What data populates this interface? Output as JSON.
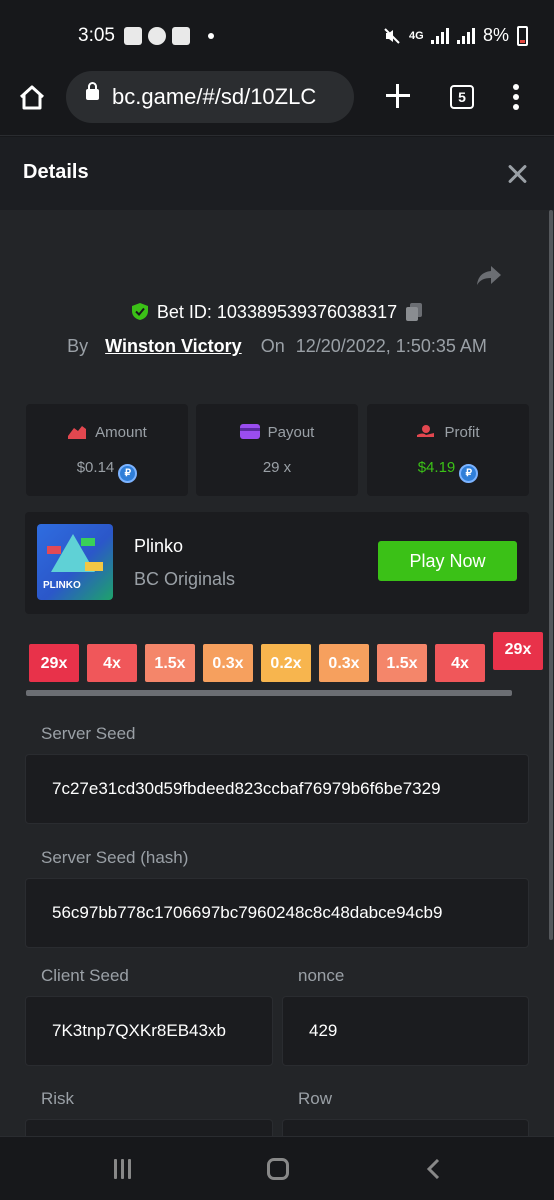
{
  "status_bar": {
    "time": "3:05",
    "network": "4G",
    "battery": "8%"
  },
  "browser": {
    "url": "bc.game/#/sd/10ZLC",
    "tab_count": "5"
  },
  "modal": {
    "title": "Details"
  },
  "bet": {
    "bet_id": "Bet ID: 103389539376038317",
    "by_label": "By",
    "user": "Winston Victory",
    "on_label": "On",
    "date": "12/20/2022, 1:50:35 AM"
  },
  "stats": [
    {
      "label": "Amount",
      "value": "$0.14",
      "color": "#9aa0a6"
    },
    {
      "label": "Payout",
      "value": "29 x",
      "color": "#9aa0a6"
    },
    {
      "label": "Profit",
      "value": "$4.19",
      "color": "#3bc117"
    }
  ],
  "game": {
    "name": "Plinko",
    "provider": "BC Originals",
    "thumb_text": "PLINKO",
    "play_label": "Play Now"
  },
  "multipliers": [
    {
      "label": "29x",
      "color": "#e8324a"
    },
    {
      "label": "4x",
      "color": "#f0575a"
    },
    {
      "label": "1.5x",
      "color": "#f4866a"
    },
    {
      "label": "0.3x",
      "color": "#f6a05e"
    },
    {
      "label": "0.2x",
      "color": "#f7b54e"
    },
    {
      "label": "0.3x",
      "color": "#f6a05e"
    },
    {
      "label": "1.5x",
      "color": "#f4866a"
    },
    {
      "label": "4x",
      "color": "#f0575a"
    },
    {
      "label": "29x",
      "color": "#e8324a",
      "hit": true
    }
  ],
  "seeds": {
    "server_seed_label": "Server Seed",
    "server_seed": "7c27e31cd30d59fbdeed823ccbaf76979b6f6be7329",
    "server_hash_label": "Server Seed (hash)",
    "server_hash": "56c97bb778c1706697bc7960248c8c48dabce94cb9",
    "client_seed_label": "Client Seed",
    "client_seed": "7K3tnp7QXKr8EB43xb",
    "nonce_label": "nonce",
    "nonce": "429",
    "risk_label": "Risk",
    "row_label": "Row"
  }
}
